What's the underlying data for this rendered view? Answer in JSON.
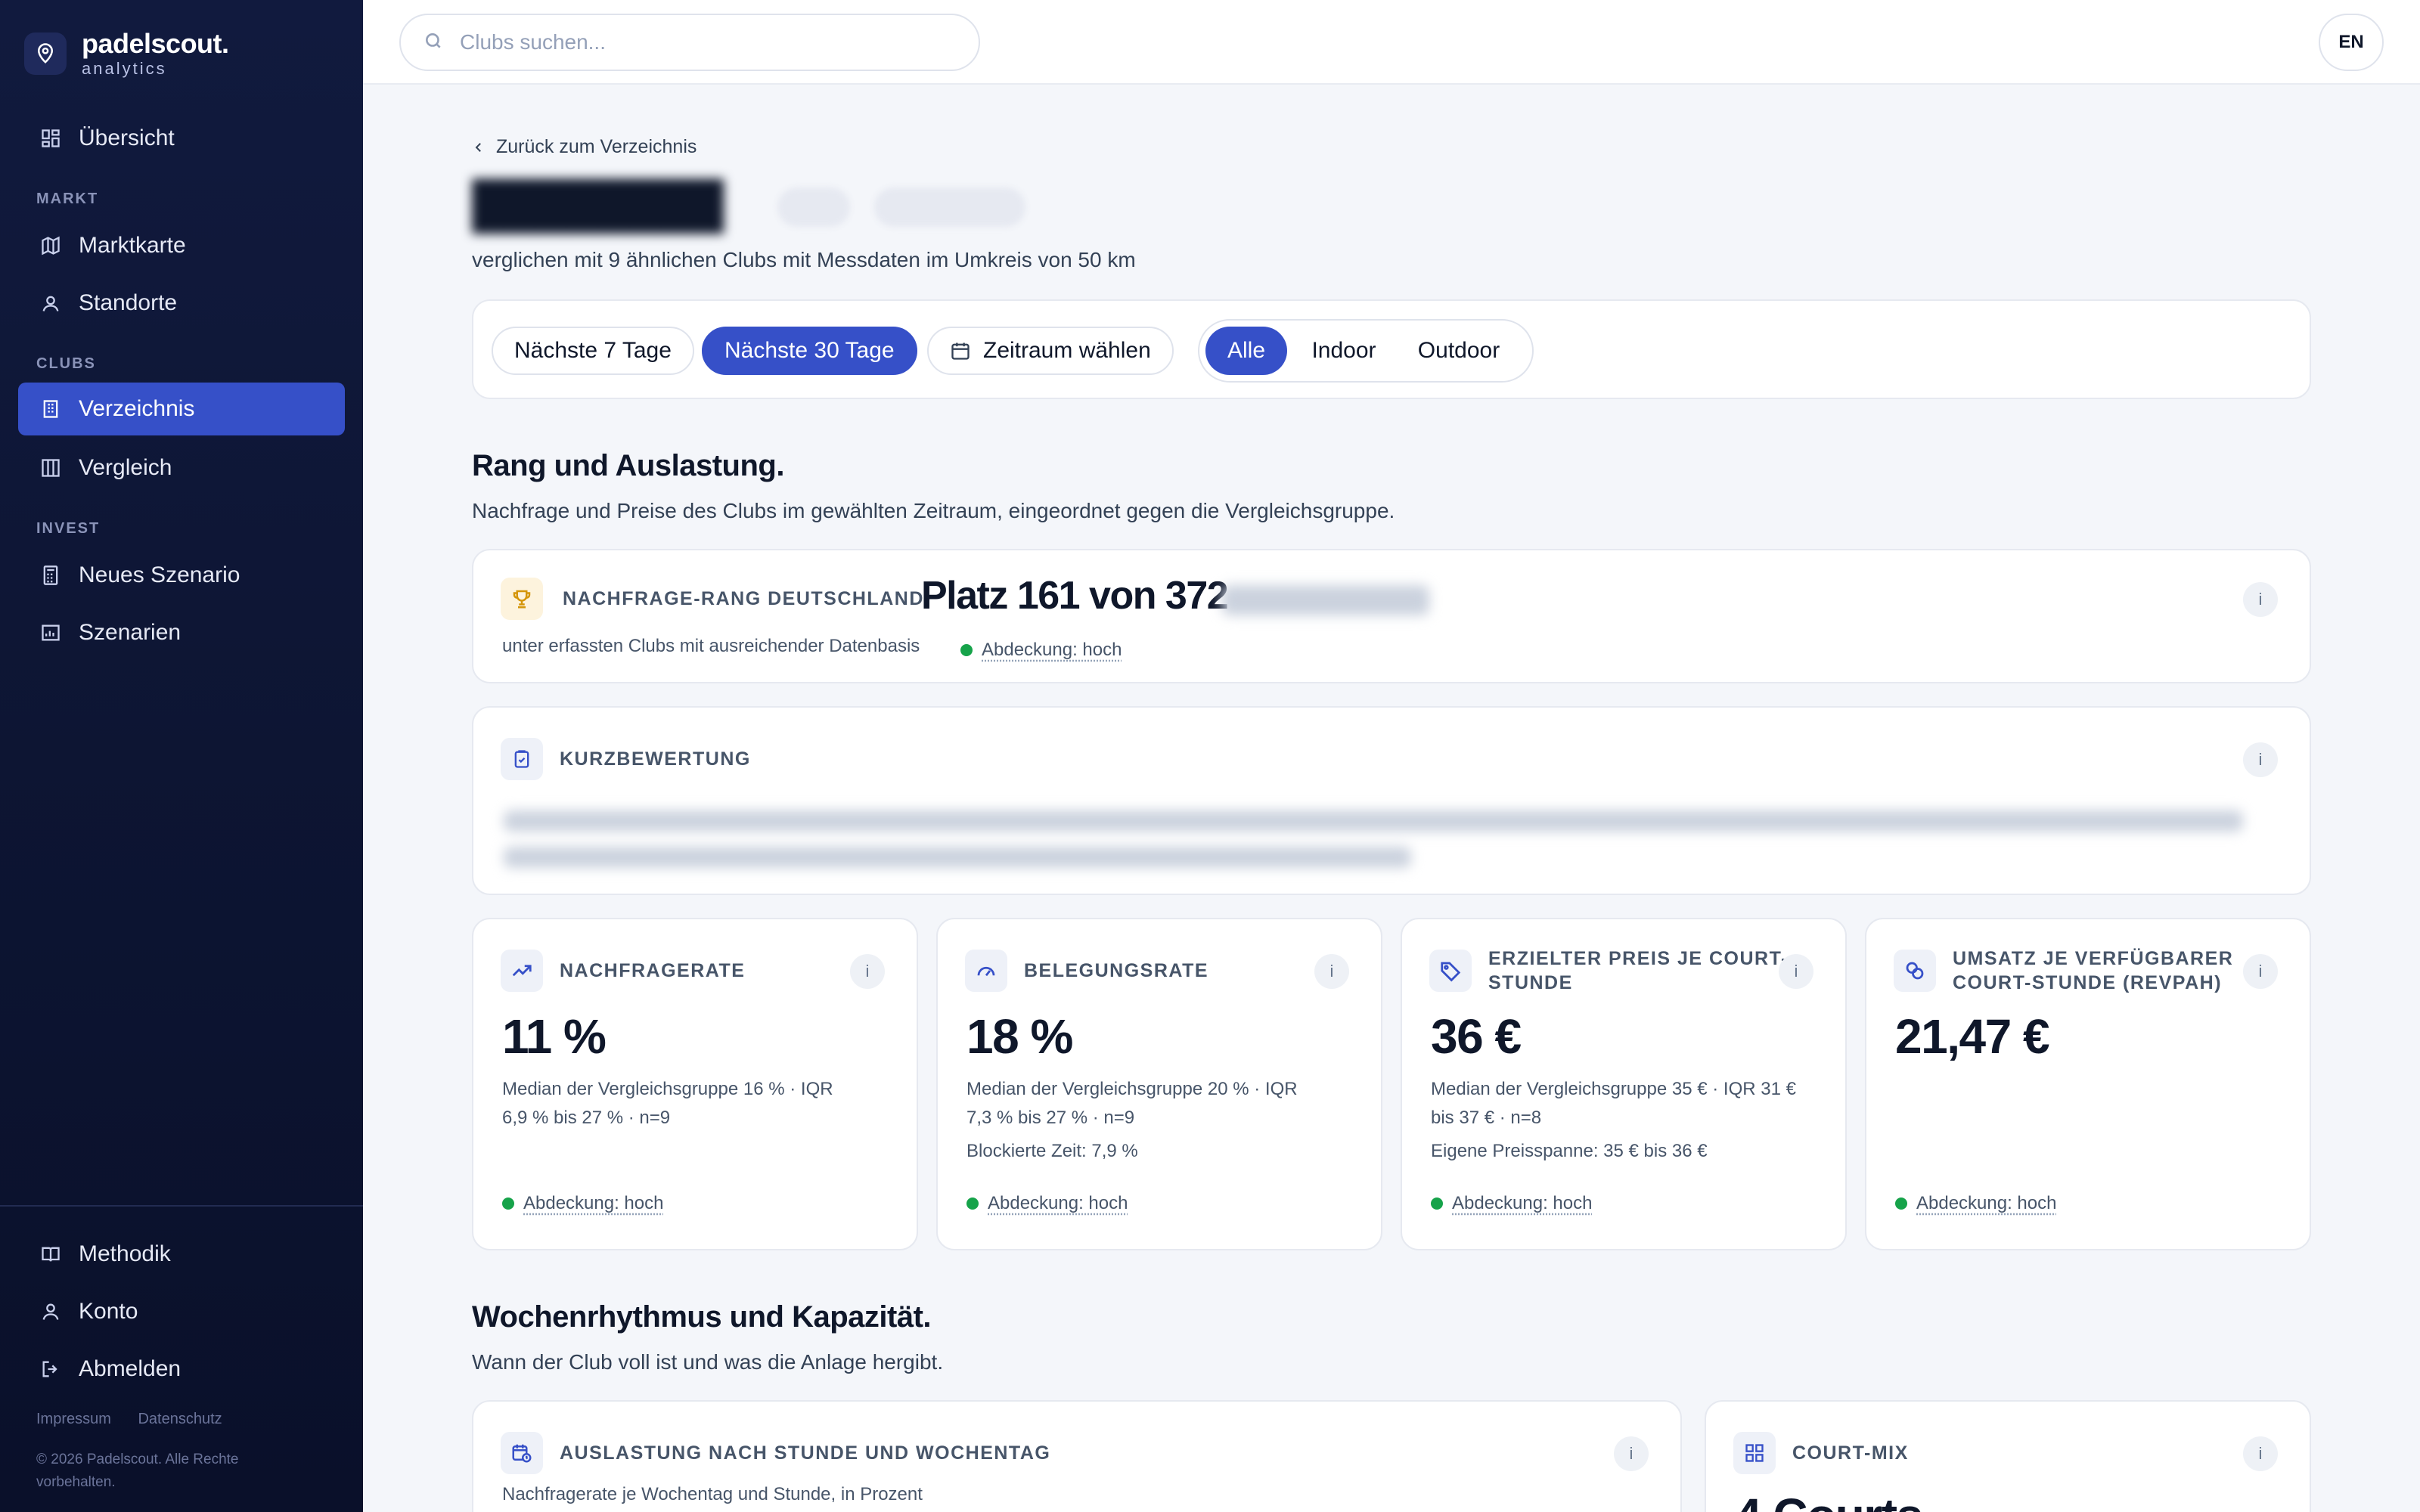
{
  "brand": {
    "name": "padelscout.",
    "sub": "analytics"
  },
  "sidebar": {
    "overview": "Übersicht",
    "sections": {
      "markt": "MARKT",
      "clubs": "CLUBS",
      "invest": "INVEST"
    },
    "markt_items": [
      "Marktkarte",
      "Standorte"
    ],
    "clubs_items": [
      "Verzeichnis",
      "Vergleich"
    ],
    "invest_items": [
      "Neues Szenario",
      "Szenarien"
    ],
    "footer_items": [
      "Methodik",
      "Konto",
      "Abmelden"
    ],
    "legal": [
      "Impressum",
      "Datenschutz"
    ],
    "copyright": "© 2026 Padelscout. Alle Rechte vorbehalten."
  },
  "topbar": {
    "search_placeholder": "Clubs suchen...",
    "lang": "EN"
  },
  "page": {
    "back": "Zurück zum Verzeichnis",
    "subtitle": "verglichen mit 9 ähnlichen Clubs mit Messdaten im Umkreis von 50 km"
  },
  "filters": {
    "ranges": [
      "Nächste 7 Tage",
      "Nächste 30 Tage",
      "Zeitraum wählen"
    ],
    "active_range": "Nächste 30 Tage",
    "types": [
      "Alle",
      "Indoor",
      "Outdoor"
    ],
    "active_type": "Alle"
  },
  "section1": {
    "title": "Rang und Auslastung.",
    "subtitle": "Nachfrage und Preise des Clubs im gewählten Zeitraum, eingeordnet gegen die Vergleichsgruppe."
  },
  "rank": {
    "label": "NACHFRAGE-RANG DEUTSCHLAND",
    "value": "Platz 161 von 372",
    "note": "unter erfassten Clubs mit ausreichender Datenbasis",
    "coverage": "Abdeckung: hoch"
  },
  "summary": {
    "label": "KURZBEWERTUNG"
  },
  "kpis": [
    {
      "label": "NACHFRAGERATE",
      "value": "11 %",
      "note1": "Median der Vergleichsgruppe 16 % · IQR",
      "note2": "6,9 % bis 27 % · n=9",
      "note3": "",
      "coverage": "Abdeckung: hoch"
    },
    {
      "label": "BELEGUNGSRATE",
      "value": "18 %",
      "note1": "Median der Vergleichsgruppe 20 % · IQR",
      "note2": "7,3 % bis 27 % · n=9",
      "note3": "Blockierte Zeit: 7,9 %",
      "coverage": "Abdeckung: hoch"
    },
    {
      "label1": "ERZIELTER PREIS JE COURT-",
      "label2": "STUNDE",
      "value": "36 €",
      "note1": "Median der Vergleichsgruppe 35 € · IQR 31 €",
      "note2": "bis 37 € · n=8",
      "note3": "Eigene Preisspanne: 35 € bis 36 €",
      "coverage": "Abdeckung: hoch"
    },
    {
      "label1": "UMSATZ JE VERFÜGBARER",
      "label2": "COURT-STUNDE (REVPAH)",
      "value": "21,47 €",
      "coverage": "Abdeckung: hoch"
    }
  ],
  "section2": {
    "title": "Wochenrhythmus und Kapazität.",
    "subtitle": "Wann der Club voll ist und was die Anlage hergibt."
  },
  "heatmap_card": {
    "label": "AUSLASTUNG NACH STUNDE UND WOCHENTAG",
    "note": "Nachfragerate je Wochentag und Stunde, in Prozent"
  },
  "courtmix_card": {
    "label": "COURT-MIX",
    "value": "4 Courts"
  },
  "colors": {
    "accent": "#3650c8",
    "sidebar": "#0d1533",
    "coverage_dot": "#16a34a"
  }
}
